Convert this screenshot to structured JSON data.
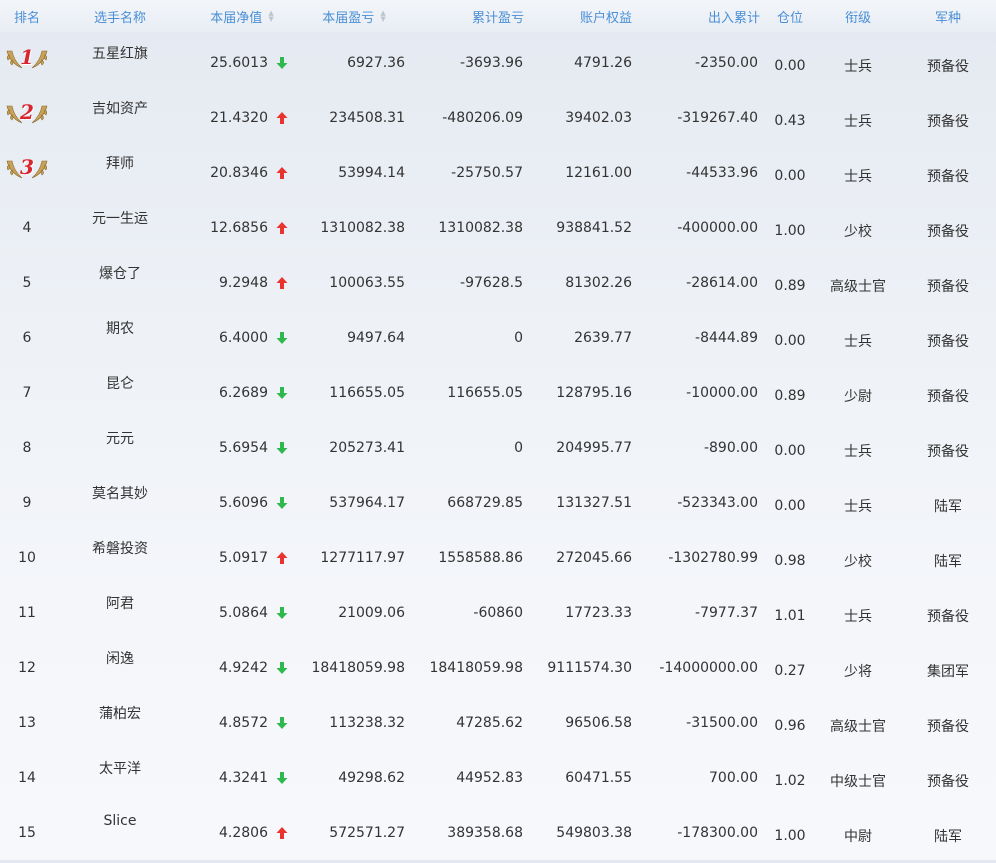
{
  "header": {
    "rank": "排名",
    "name": "选手名称",
    "nav": "本届净值",
    "period_pnl": "本届盈亏",
    "cum_pnl": "累计盈亏",
    "equity": "账户权益",
    "io": "出入累计",
    "position": "仓位",
    "grade": "衔级",
    "army": "军种"
  },
  "colors": {
    "up": "#e8332f",
    "down": "#2fb84e",
    "header_text": "#4a8fd6",
    "medal_gold": "#c9a25a"
  },
  "rows": [
    {
      "rank": "1",
      "medal": true,
      "name": "五星红旗",
      "nav": "25.6013",
      "trend": "down",
      "period": "6927.36",
      "cum": "-3693.96",
      "equity": "4791.26",
      "io": "-2350.00",
      "pos": "0.00",
      "grade": "士兵",
      "army": "预备役"
    },
    {
      "rank": "2",
      "medal": true,
      "name": "吉如资产",
      "nav": "21.4320",
      "trend": "up",
      "period": "234508.31",
      "cum": "-480206.09",
      "equity": "39402.03",
      "io": "-319267.40",
      "pos": "0.43",
      "grade": "士兵",
      "army": "预备役"
    },
    {
      "rank": "3",
      "medal": true,
      "name": "拜师",
      "nav": "20.8346",
      "trend": "up",
      "period": "53994.14",
      "cum": "-25750.57",
      "equity": "12161.00",
      "io": "-44533.96",
      "pos": "0.00",
      "grade": "士兵",
      "army": "预备役"
    },
    {
      "rank": "4",
      "medal": false,
      "name": "元一生运",
      "nav": "12.6856",
      "trend": "up",
      "period": "1310082.38",
      "cum": "1310082.38",
      "equity": "938841.52",
      "io": "-400000.00",
      "pos": "1.00",
      "grade": "少校",
      "army": "预备役"
    },
    {
      "rank": "5",
      "medal": false,
      "name": "爆仓了",
      "nav": "9.2948",
      "trend": "up",
      "period": "100063.55",
      "cum": "-97628.5",
      "equity": "81302.26",
      "io": "-28614.00",
      "pos": "0.89",
      "grade": "高级士官",
      "army": "预备役"
    },
    {
      "rank": "6",
      "medal": false,
      "name": "期农",
      "nav": "6.4000",
      "trend": "down",
      "period": "9497.64",
      "cum": "0",
      "equity": "2639.77",
      "io": "-8444.89",
      "pos": "0.00",
      "grade": "士兵",
      "army": "预备役"
    },
    {
      "rank": "7",
      "medal": false,
      "name": "昆仑",
      "nav": "6.2689",
      "trend": "down",
      "period": "116655.05",
      "cum": "116655.05",
      "equity": "128795.16",
      "io": "-10000.00",
      "pos": "0.89",
      "grade": "少尉",
      "army": "预备役"
    },
    {
      "rank": "8",
      "medal": false,
      "name": "元元",
      "nav": "5.6954",
      "trend": "down",
      "period": "205273.41",
      "cum": "0",
      "equity": "204995.77",
      "io": "-890.00",
      "pos": "0.00",
      "grade": "士兵",
      "army": "预备役"
    },
    {
      "rank": "9",
      "medal": false,
      "name": "莫名其妙",
      "nav": "5.6096",
      "trend": "down",
      "period": "537964.17",
      "cum": "668729.85",
      "equity": "131327.51",
      "io": "-523343.00",
      "pos": "0.00",
      "grade": "士兵",
      "army": "陆军"
    },
    {
      "rank": "10",
      "medal": false,
      "name": "希磐投资",
      "nav": "5.0917",
      "trend": "up",
      "period": "1277117.97",
      "cum": "1558588.86",
      "equity": "272045.66",
      "io": "-1302780.99",
      "pos": "0.98",
      "grade": "少校",
      "army": "陆军"
    },
    {
      "rank": "11",
      "medal": false,
      "name": "阿君",
      "nav": "5.0864",
      "trend": "down",
      "period": "21009.06",
      "cum": "-60860",
      "equity": "17723.33",
      "io": "-7977.37",
      "pos": "1.01",
      "grade": "士兵",
      "army": "预备役"
    },
    {
      "rank": "12",
      "medal": false,
      "name": "闲逸",
      "nav": "4.9242",
      "trend": "down",
      "period": "18418059.98",
      "cum": "18418059.98",
      "equity": "9111574.30",
      "io": "-14000000.00",
      "pos": "0.27",
      "grade": "少将",
      "army": "集团军"
    },
    {
      "rank": "13",
      "medal": false,
      "name": "蒲柏宏",
      "nav": "4.8572",
      "trend": "down",
      "period": "113238.32",
      "cum": "47285.62",
      "equity": "96506.58",
      "io": "-31500.00",
      "pos": "0.96",
      "grade": "高级士官",
      "army": "预备役"
    },
    {
      "rank": "14",
      "medal": false,
      "name": "太平洋",
      "nav": "4.3241",
      "trend": "down",
      "period": "49298.62",
      "cum": "44952.83",
      "equity": "60471.55",
      "io": "700.00",
      "pos": "1.02",
      "grade": "中级士官",
      "army": "预备役"
    },
    {
      "rank": "15",
      "medal": false,
      "name": "Slice",
      "nav": "4.2806",
      "trend": "up",
      "period": "572571.27",
      "cum": "389358.68",
      "equity": "549803.38",
      "io": "-178300.00",
      "pos": "1.00",
      "grade": "中尉",
      "army": "陆军"
    }
  ]
}
